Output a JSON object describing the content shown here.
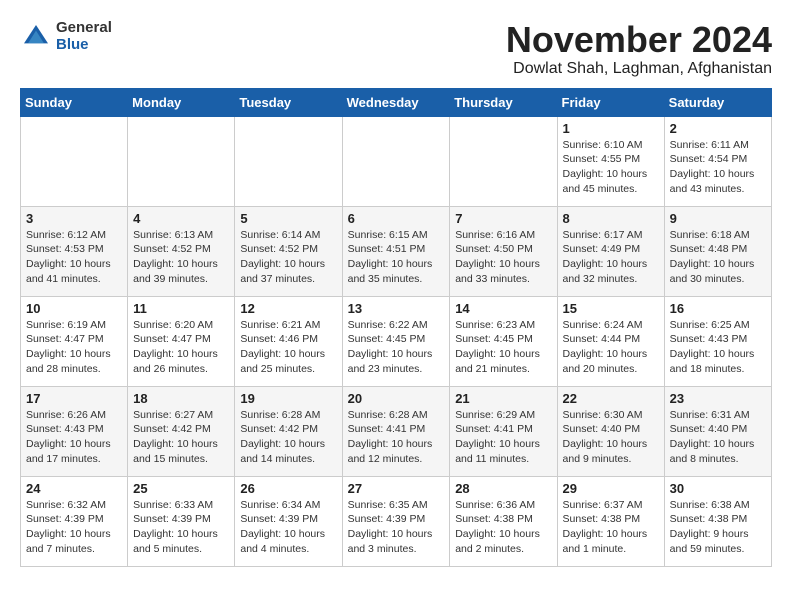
{
  "logo": {
    "general": "General",
    "blue": "Blue"
  },
  "title": {
    "month": "November 2024",
    "location": "Dowlat Shah, Laghman, Afghanistan"
  },
  "weekdays": [
    "Sunday",
    "Monday",
    "Tuesday",
    "Wednesday",
    "Thursday",
    "Friday",
    "Saturday"
  ],
  "weeks": [
    {
      "days": [
        {
          "num": "",
          "info": ""
        },
        {
          "num": "",
          "info": ""
        },
        {
          "num": "",
          "info": ""
        },
        {
          "num": "",
          "info": ""
        },
        {
          "num": "",
          "info": ""
        },
        {
          "num": "1",
          "info": "Sunrise: 6:10 AM\nSunset: 4:55 PM\nDaylight: 10 hours\nand 45 minutes."
        },
        {
          "num": "2",
          "info": "Sunrise: 6:11 AM\nSunset: 4:54 PM\nDaylight: 10 hours\nand 43 minutes."
        }
      ]
    },
    {
      "days": [
        {
          "num": "3",
          "info": "Sunrise: 6:12 AM\nSunset: 4:53 PM\nDaylight: 10 hours\nand 41 minutes."
        },
        {
          "num": "4",
          "info": "Sunrise: 6:13 AM\nSunset: 4:52 PM\nDaylight: 10 hours\nand 39 minutes."
        },
        {
          "num": "5",
          "info": "Sunrise: 6:14 AM\nSunset: 4:52 PM\nDaylight: 10 hours\nand 37 minutes."
        },
        {
          "num": "6",
          "info": "Sunrise: 6:15 AM\nSunset: 4:51 PM\nDaylight: 10 hours\nand 35 minutes."
        },
        {
          "num": "7",
          "info": "Sunrise: 6:16 AM\nSunset: 4:50 PM\nDaylight: 10 hours\nand 33 minutes."
        },
        {
          "num": "8",
          "info": "Sunrise: 6:17 AM\nSunset: 4:49 PM\nDaylight: 10 hours\nand 32 minutes."
        },
        {
          "num": "9",
          "info": "Sunrise: 6:18 AM\nSunset: 4:48 PM\nDaylight: 10 hours\nand 30 minutes."
        }
      ]
    },
    {
      "days": [
        {
          "num": "10",
          "info": "Sunrise: 6:19 AM\nSunset: 4:47 PM\nDaylight: 10 hours\nand 28 minutes."
        },
        {
          "num": "11",
          "info": "Sunrise: 6:20 AM\nSunset: 4:47 PM\nDaylight: 10 hours\nand 26 minutes."
        },
        {
          "num": "12",
          "info": "Sunrise: 6:21 AM\nSunset: 4:46 PM\nDaylight: 10 hours\nand 25 minutes."
        },
        {
          "num": "13",
          "info": "Sunrise: 6:22 AM\nSunset: 4:45 PM\nDaylight: 10 hours\nand 23 minutes."
        },
        {
          "num": "14",
          "info": "Sunrise: 6:23 AM\nSunset: 4:45 PM\nDaylight: 10 hours\nand 21 minutes."
        },
        {
          "num": "15",
          "info": "Sunrise: 6:24 AM\nSunset: 4:44 PM\nDaylight: 10 hours\nand 20 minutes."
        },
        {
          "num": "16",
          "info": "Sunrise: 6:25 AM\nSunset: 4:43 PM\nDaylight: 10 hours\nand 18 minutes."
        }
      ]
    },
    {
      "days": [
        {
          "num": "17",
          "info": "Sunrise: 6:26 AM\nSunset: 4:43 PM\nDaylight: 10 hours\nand 17 minutes."
        },
        {
          "num": "18",
          "info": "Sunrise: 6:27 AM\nSunset: 4:42 PM\nDaylight: 10 hours\nand 15 minutes."
        },
        {
          "num": "19",
          "info": "Sunrise: 6:28 AM\nSunset: 4:42 PM\nDaylight: 10 hours\nand 14 minutes."
        },
        {
          "num": "20",
          "info": "Sunrise: 6:28 AM\nSunset: 4:41 PM\nDaylight: 10 hours\nand 12 minutes."
        },
        {
          "num": "21",
          "info": "Sunrise: 6:29 AM\nSunset: 4:41 PM\nDaylight: 10 hours\nand 11 minutes."
        },
        {
          "num": "22",
          "info": "Sunrise: 6:30 AM\nSunset: 4:40 PM\nDaylight: 10 hours\nand 9 minutes."
        },
        {
          "num": "23",
          "info": "Sunrise: 6:31 AM\nSunset: 4:40 PM\nDaylight: 10 hours\nand 8 minutes."
        }
      ]
    },
    {
      "days": [
        {
          "num": "24",
          "info": "Sunrise: 6:32 AM\nSunset: 4:39 PM\nDaylight: 10 hours\nand 7 minutes."
        },
        {
          "num": "25",
          "info": "Sunrise: 6:33 AM\nSunset: 4:39 PM\nDaylight: 10 hours\nand 5 minutes."
        },
        {
          "num": "26",
          "info": "Sunrise: 6:34 AM\nSunset: 4:39 PM\nDaylight: 10 hours\nand 4 minutes."
        },
        {
          "num": "27",
          "info": "Sunrise: 6:35 AM\nSunset: 4:39 PM\nDaylight: 10 hours\nand 3 minutes."
        },
        {
          "num": "28",
          "info": "Sunrise: 6:36 AM\nSunset: 4:38 PM\nDaylight: 10 hours\nand 2 minutes."
        },
        {
          "num": "29",
          "info": "Sunrise: 6:37 AM\nSunset: 4:38 PM\nDaylight: 10 hours\nand 1 minute."
        },
        {
          "num": "30",
          "info": "Sunrise: 6:38 AM\nSunset: 4:38 PM\nDaylight: 9 hours\nand 59 minutes."
        }
      ]
    }
  ]
}
